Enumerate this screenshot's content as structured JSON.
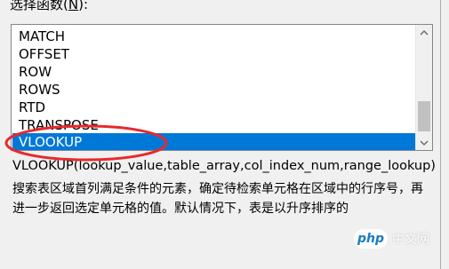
{
  "dialog": {
    "section_label_prefix": "选择函数(",
    "section_label_key": "N",
    "section_label_suffix": "):"
  },
  "function_list": {
    "items": [
      "MATCH",
      "OFFSET",
      "ROW",
      "ROWS",
      "RTD",
      "TRANSPOSE",
      "VLOOKUP"
    ],
    "selected": "VLOOKUP"
  },
  "signature": "VLOOKUP(lookup_value,table_array,col_index_num,range_lookup)",
  "description": "搜索表区域首列满足条件的元素，确定待检索单元格在区域中的行序号，再进一步返回选定单元格的值。默认情况下，表是以升序排序的",
  "watermark": {
    "logo": "php",
    "text": "中文网"
  },
  "colors": {
    "selection": "#0078d7",
    "annotation": "#e8292b"
  },
  "icons": [
    "scroll-up-arrow-icon",
    "scroll-down-arrow-icon",
    "php-logo-icon"
  ]
}
